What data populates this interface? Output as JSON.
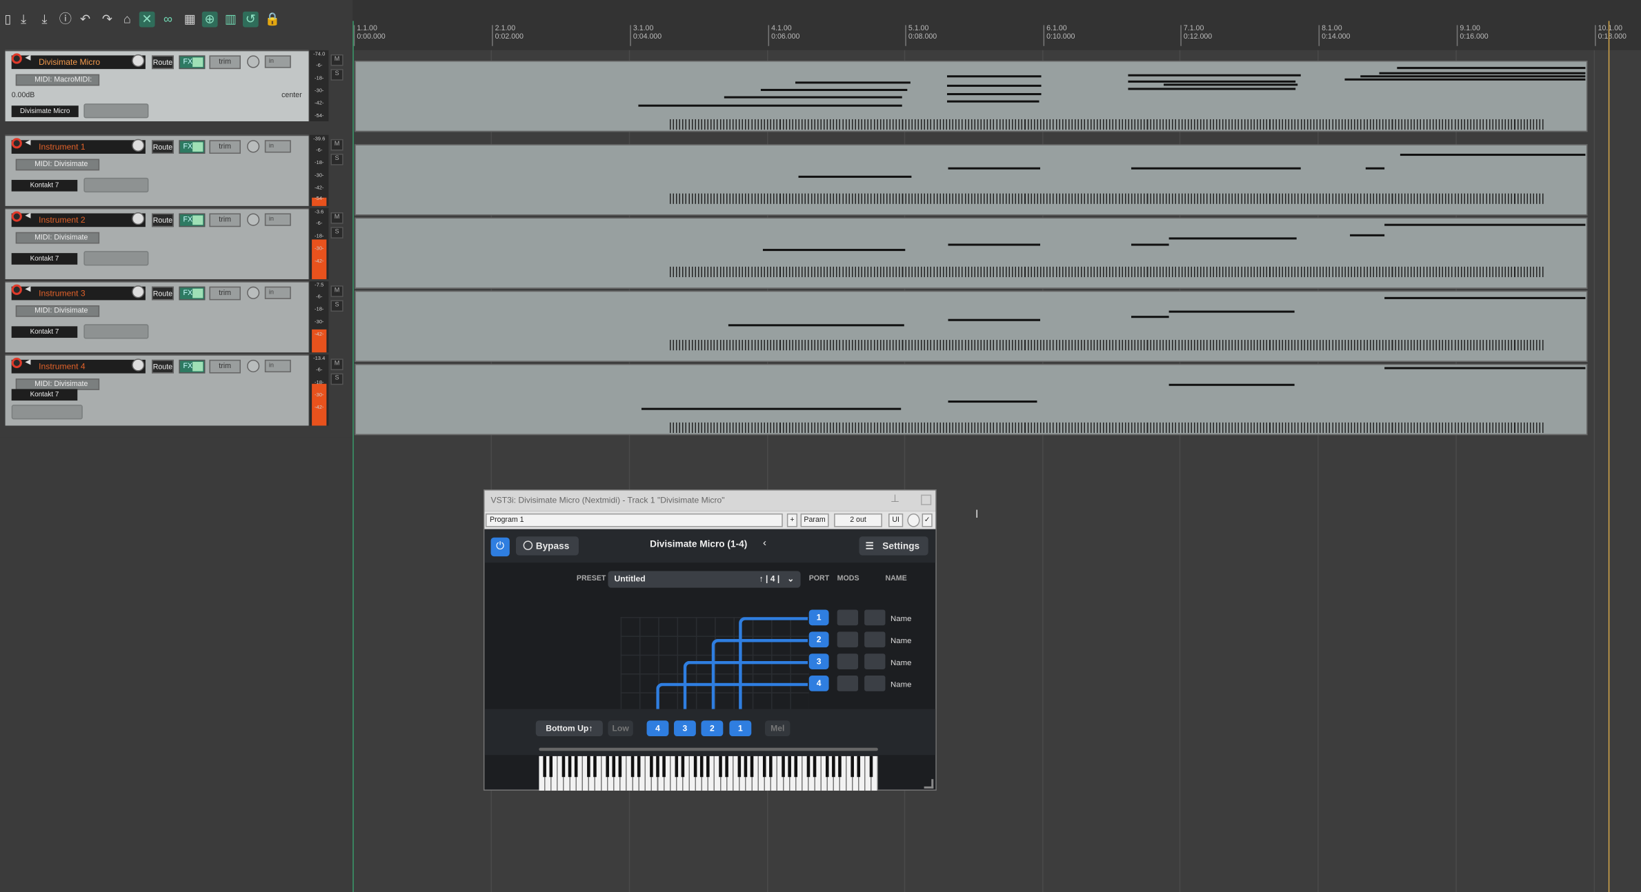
{
  "toolbar": {
    "icons": [
      "new-project-icon",
      "save-icon",
      "save-as-icon",
      "info-icon",
      "undo-icon",
      "redo-icon",
      "metronome-icon",
      "ripple-icon",
      "snap-icon",
      "grid-icon",
      "lock-icon"
    ]
  },
  "ruler": {
    "bars": [
      {
        "label": "1.1.00\n0:00.000"
      },
      {
        "label": "2.1.00\n0:02.000"
      },
      {
        "label": "3.1.00\n0:04.000"
      },
      {
        "label": "4.1.00\n0:06.000"
      },
      {
        "label": "5.1.00\n0:08.000"
      },
      {
        "label": "6.1.00\n0:10.000"
      },
      {
        "label": "7.1.00\n0:12.000"
      },
      {
        "label": "8.1.00\n0:14.000"
      },
      {
        "label": "9.1.00\n0:16.000"
      },
      {
        "label": "10.1.00\n0:18.000"
      }
    ]
  },
  "tracks": [
    {
      "name": "Divisimate Micro",
      "midi": "MIDI: MacroMIDI:",
      "plugin": "Divisimate Micro",
      "volume": "0.00dB",
      "pan": "center",
      "route": "Route",
      "fx": "FX",
      "trim": "trim",
      "in": "in",
      "meter_peak": "-74.0",
      "meter_labels": [
        "-6-",
        "-18-",
        "-30-",
        "-42-",
        "-54-"
      ]
    },
    {
      "name": "Instrument 1",
      "midi": "MIDI: Divisimate",
      "plugin": "Kontakt 7",
      "route": "Route",
      "fx": "FX",
      "trim": "trim",
      "in": "in",
      "meter_peak": "-39.6",
      "meter_labels": [
        "-6-",
        "-18-",
        "-30-",
        "-42-",
        "-54-"
      ]
    },
    {
      "name": "Instrument 2",
      "midi": "MIDI: Divisimate",
      "plugin": "Kontakt 7",
      "route": "Route",
      "fx": "FX",
      "trim": "trim",
      "in": "in",
      "meter_peak": "-3.6",
      "meter_labels": [
        "-6-",
        "-18-",
        "-30-",
        "-42-"
      ]
    },
    {
      "name": "Instrument 3",
      "midi": "MIDI: Divisimate",
      "plugin": "Kontakt 7",
      "route": "Route",
      "fx": "FX",
      "trim": "trim",
      "in": "in",
      "meter_peak": "-7.5",
      "meter_labels": [
        "-6-",
        "-18-",
        "-30-",
        "-42-"
      ]
    },
    {
      "name": "Instrument 4",
      "midi": "MIDI: Divisimate",
      "plugin": "Kontakt 7",
      "route": "Route",
      "fx": "FX",
      "trim": "trim",
      "in": "in",
      "meter_peak": "-13.4",
      "meter_labels": [
        "-6-",
        "-18-",
        "-30-",
        "-42-"
      ]
    }
  ],
  "ms": {
    "m": "M",
    "s": "S"
  },
  "plugin": {
    "title": "VST3i: Divisimate Micro (Nextmidi) - Track 1 \"Divisimate Micro\"",
    "program": "Program 1",
    "plus": "+",
    "param": "Param",
    "out": "2 out",
    "ui": "UI",
    "bypass": "Bypass",
    "name": "Divisimate Micro  (1-4)",
    "settings": "Settings",
    "preset_label": "PRESET",
    "preset": "Untitled",
    "preset_nav": "↑ | 4 |",
    "col_port": "PORT",
    "col_mods": "MODS",
    "col_name": "NAME",
    "ports": [
      {
        "num": "1",
        "name": "Name"
      },
      {
        "num": "2",
        "name": "Name"
      },
      {
        "num": "3",
        "name": "Name"
      },
      {
        "num": "4",
        "name": "Name"
      }
    ],
    "order": "Bottom Up↑",
    "low": "Low",
    "mel": "Mel",
    "order_buttons": [
      "4",
      "3",
      "2",
      "1"
    ]
  }
}
